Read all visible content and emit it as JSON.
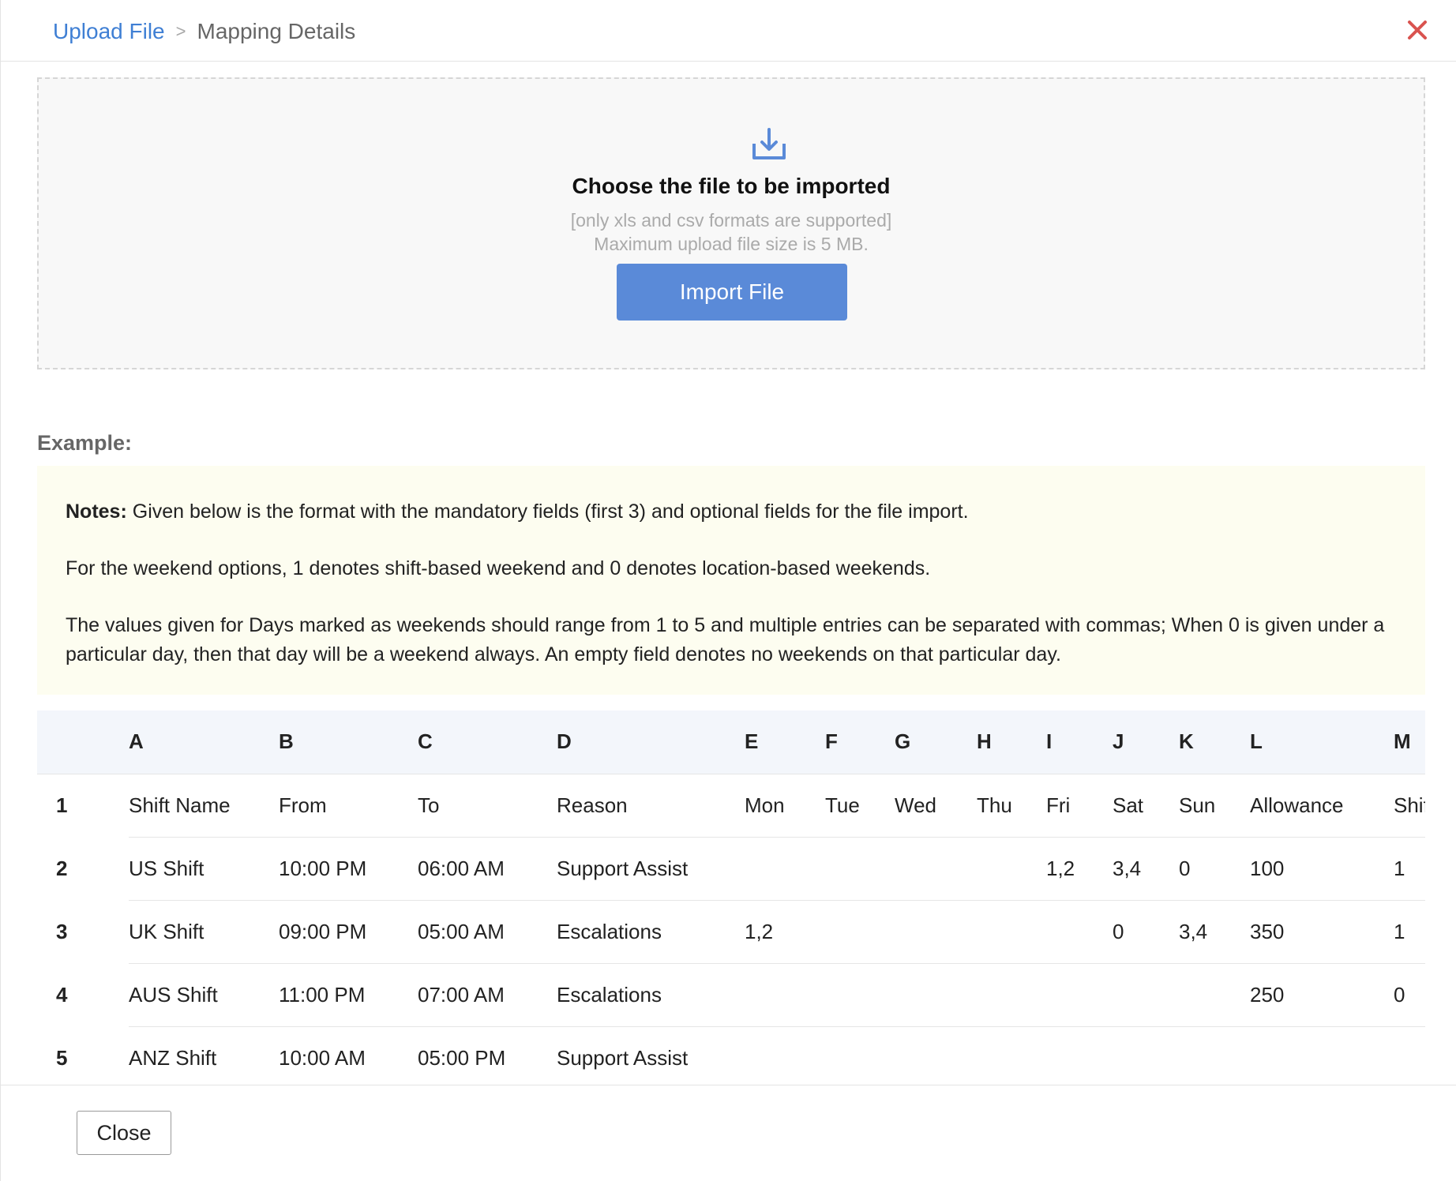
{
  "header": {
    "breadcrumb_link": "Upload File",
    "breadcrumb_separator": ">",
    "breadcrumb_current": "Mapping Details",
    "close_icon": "close-x-icon",
    "close_color": "#d9534f"
  },
  "dropzone": {
    "icon": "download-tray-icon",
    "icon_color": "#5a8ad8",
    "title": "Choose the file to be imported",
    "hint_formats": "[only xls and csv formats are supported]",
    "hint_size": "Maximum upload file size is 5 MB.",
    "import_button": "Import File",
    "button_color": "#5a8ad8"
  },
  "example": {
    "label": "Example:",
    "notes_label": "Notes:",
    "note_1": " Given below is the format with the mandatory fields (first 3) and optional fields for the file import.",
    "note_2": "For the weekend options, 1 denotes shift-based weekend and 0 denotes location-based weekends.",
    "note_3": "The values given for Days marked as weekends should range from 1 to 5 and multiple entries can be separated with commas; When 0 is given under a particular day, then that day will be a weekend always. An empty field denotes no weekends on that particular day."
  },
  "table": {
    "columns": [
      "",
      "A",
      "B",
      "C",
      "D",
      "E",
      "F",
      "G",
      "H",
      "I",
      "J",
      "K",
      "L",
      "M"
    ],
    "rows": [
      [
        "1",
        "Shift Name",
        "From",
        "To",
        "Reason",
        "Mon",
        "Tue",
        "Wed",
        "Thu",
        "Fri",
        "Sat",
        "Sun",
        "Allowance",
        "Shift"
      ],
      [
        "2",
        "US Shift",
        "10:00 PM",
        "06:00 AM",
        "Support Assist",
        "",
        "",
        "",
        "",
        "1,2",
        "3,4",
        "0",
        "100",
        "1"
      ],
      [
        "3",
        "UK Shift",
        "09:00 PM",
        "05:00 AM",
        "Escalations",
        "1,2",
        "",
        "",
        "",
        "",
        "0",
        "3,4",
        "350",
        "1"
      ],
      [
        "4",
        "AUS Shift",
        "11:00 PM",
        "07:00 AM",
        "Escalations",
        "",
        "",
        "",
        "",
        "",
        "",
        "",
        "250",
        "0"
      ],
      [
        "5",
        "ANZ Shift",
        "10:00 AM",
        "05:00 PM",
        "Support Assist",
        "",
        "",
        "",
        "",
        "",
        "",
        "",
        "",
        ""
      ]
    ]
  },
  "footer": {
    "close_button": "Close"
  }
}
